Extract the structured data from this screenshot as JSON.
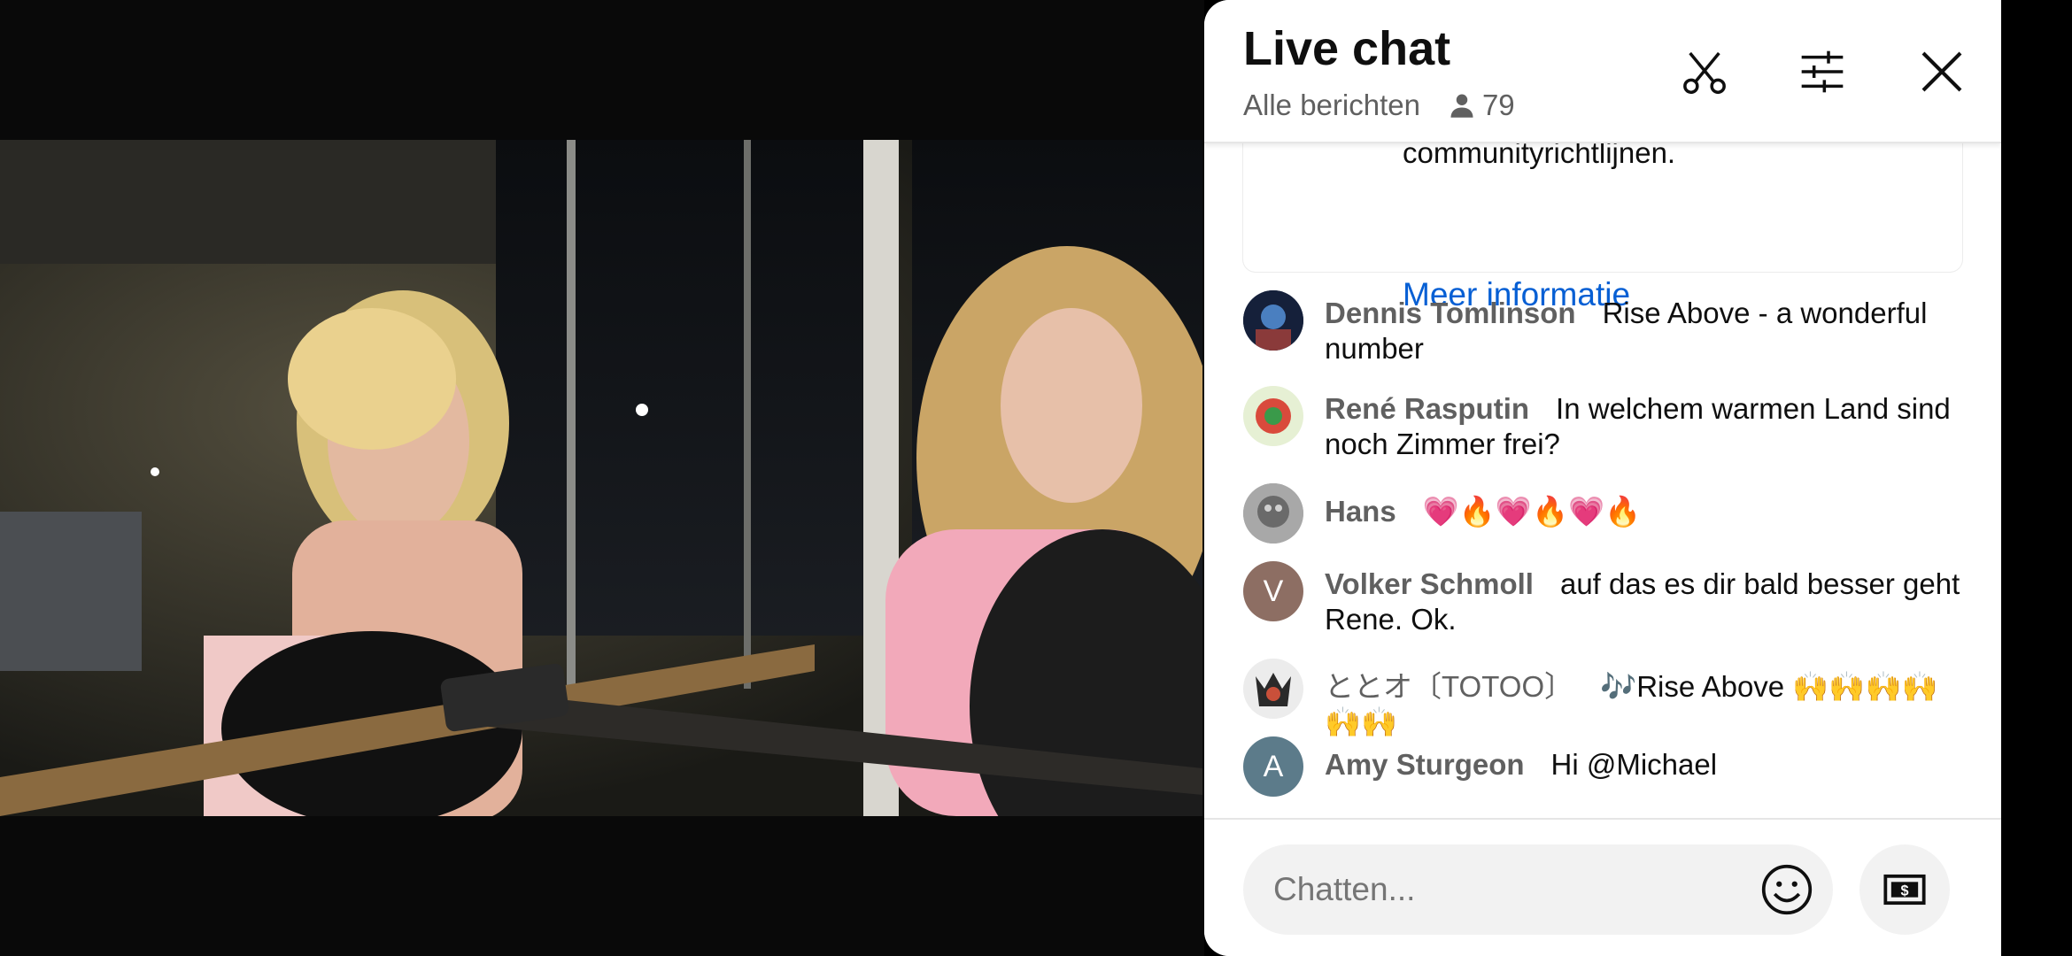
{
  "header": {
    "title": "Live chat",
    "filter_label": "Alle berichten",
    "viewer_count": "79",
    "icons": [
      "scissors-icon",
      "filter-sliders-icon",
      "close-icon"
    ]
  },
  "notice": {
    "text_tail": "communityrichtlijnen.",
    "link": "Meer informatie"
  },
  "messages": [
    {
      "author": "Dennis Tomlinson",
      "text": "Rise Above - a wonderful number"
    },
    {
      "author": "René Rasputin",
      "text": "In welchem warmen Land sind noch Zimmer frei?"
    },
    {
      "author": "Hans",
      "text": "💗🔥💗🔥💗🔥"
    },
    {
      "author": "Volker Schmoll",
      "avatar_letter": "V",
      "text": "auf das es dir bald besser geht Rene. Ok."
    },
    {
      "author": "ととオ〔TOTOO〕",
      "text": "🎶Rise Above 🙌🙌🙌🙌🙌🙌"
    },
    {
      "author": "Amy Sturgeon",
      "avatar_letter": "A",
      "text": "Hi @Michael"
    }
  ],
  "footer": {
    "input_placeholder": "Chatten...",
    "icons": [
      "emoji-icon",
      "super-chat-money-icon"
    ]
  },
  "colors": {
    "link": "#065fd4",
    "author": "#606060",
    "avatar_v": "#8d6e63",
    "avatar_a": "#5c7b8a"
  }
}
